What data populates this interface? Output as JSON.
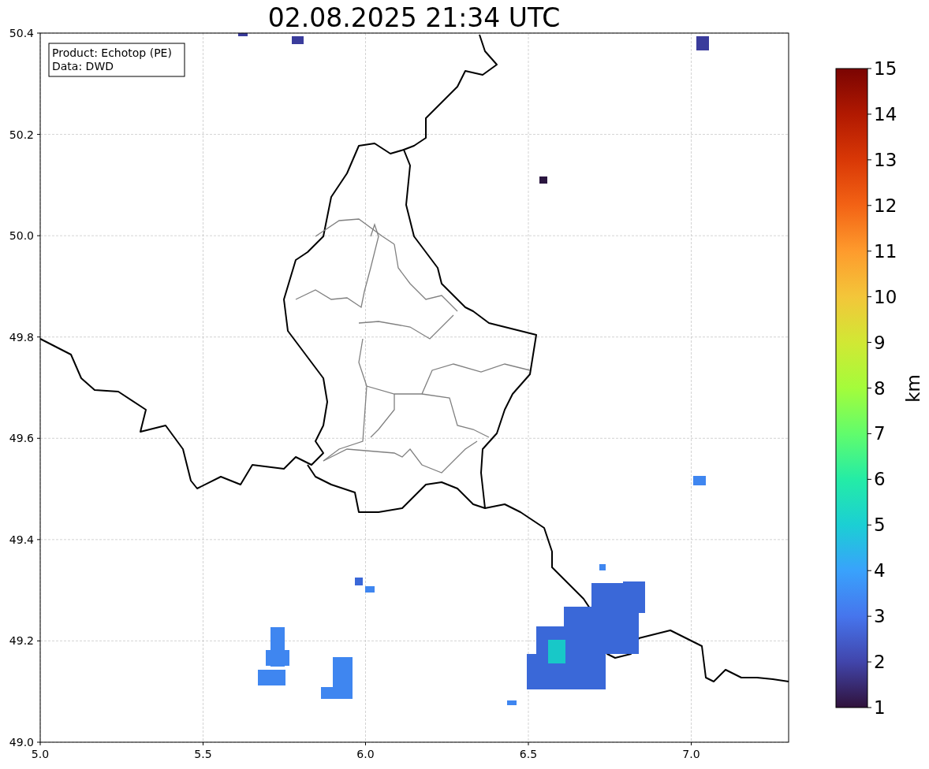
{
  "title": "02.08.2025 21:34 UTC",
  "legend": [
    "Product: Echotop (PE)",
    "Data: DWD"
  ],
  "map": {
    "xticks": [
      "5.0",
      "5.5",
      "6.0",
      "6.5",
      "7.0"
    ],
    "yticks": [
      "50.4",
      "50.2",
      "50.0",
      "49.8",
      "49.6",
      "49.4",
      "49.2",
      "49.0"
    ]
  },
  "colorbar": {
    "label": "km",
    "ticks": [
      "15",
      "14",
      "13",
      "12",
      "11",
      "10",
      "9",
      "8",
      "7",
      "6",
      "5",
      "4",
      "3",
      "2",
      "1"
    ]
  }
}
